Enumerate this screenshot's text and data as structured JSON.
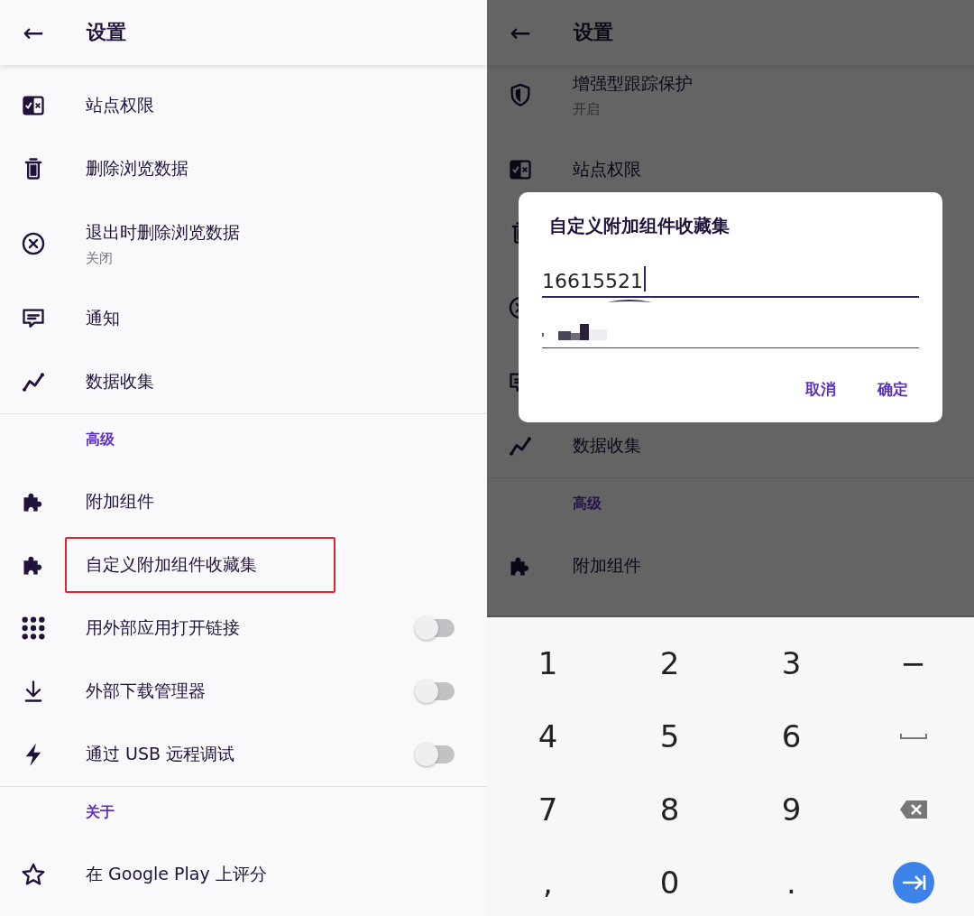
{
  "screens": [
    {
      "header": {
        "back": "←",
        "title": "设置"
      },
      "groups": [
        {
          "items": [
            {
              "label": "站点权限",
              "highlighted": false
            },
            {
              "label": "删除浏览数据",
              "highlighted": false
            },
            {
              "label": "退出时删除浏览数据",
              "summary": "关闭",
              "highlighted": false
            },
            {
              "label": "通知",
              "highlighted": false
            },
            {
              "label": "数据收集",
              "highlighted": false
            }
          ]
        },
        {
          "heading": "高级",
          "items": [
            {
              "label": "附加组件",
              "highlighted": false
            },
            {
              "label": "自定义附加组件收藏集",
              "highlighted": true
            },
            {
              "label": "用外部应用打开链接",
              "highlighted": false,
              "switch": {
                "on": false
              }
            },
            {
              "label": "外部下载管理器",
              "highlighted": false,
              "switch": {
                "on": false
              }
            },
            {
              "label": "通过 USB 远程调试",
              "highlighted": false,
              "switch": {
                "on": false
              }
            }
          ]
        },
        {
          "heading": "关于",
          "items": [
            {
              "label": "在 Google Play 上评分",
              "highlighted": false
            }
          ]
        }
      ]
    },
    {
      "header": {
        "back": "←",
        "title": "设置"
      },
      "dimmed": true,
      "groups": [
        {
          "items": [
            {
              "kind": "setting",
              "label": "增强型跟踪保护",
              "summary": "开启"
            },
            {
              "kind": "setting",
              "label": "站点权限"
            },
            {
              "kind": "covered"
            },
            {
              "kind": "covered-tall"
            },
            {
              "kind": "covered"
            },
            {
              "kind": "setting",
              "label": "数据收集"
            }
          ]
        },
        {
          "heading": "高级",
          "items": [
            {
              "kind": "setting",
              "label": "附加组件"
            }
          ]
        }
      ],
      "dialog": {
        "title": "自定义附加组件收藏集",
        "fields": [
          {
            "value": "16615521",
            "focused": true
          },
          {
            "focused": false
          }
        ],
        "buttons": [
          "取消",
          "确定"
        ]
      },
      "keyboard": {
        "keys": [
          {
            "kind": "char",
            "label": "1"
          },
          {
            "kind": "char",
            "label": "2"
          },
          {
            "kind": "char",
            "label": "3"
          },
          {
            "kind": "char",
            "label": "−"
          },
          {
            "kind": "char",
            "label": "4"
          },
          {
            "kind": "char",
            "label": "5"
          },
          {
            "kind": "char",
            "label": "6"
          },
          {
            "kind": "space"
          },
          {
            "kind": "char",
            "label": "7"
          },
          {
            "kind": "char",
            "label": "8"
          },
          {
            "kind": "char",
            "label": "9"
          },
          {
            "kind": "backspace"
          },
          {
            "kind": "char",
            "label": ","
          },
          {
            "kind": "char",
            "label": "0"
          },
          {
            "kind": "char",
            "label": "."
          },
          {
            "kind": "next"
          }
        ]
      }
    }
  ]
}
